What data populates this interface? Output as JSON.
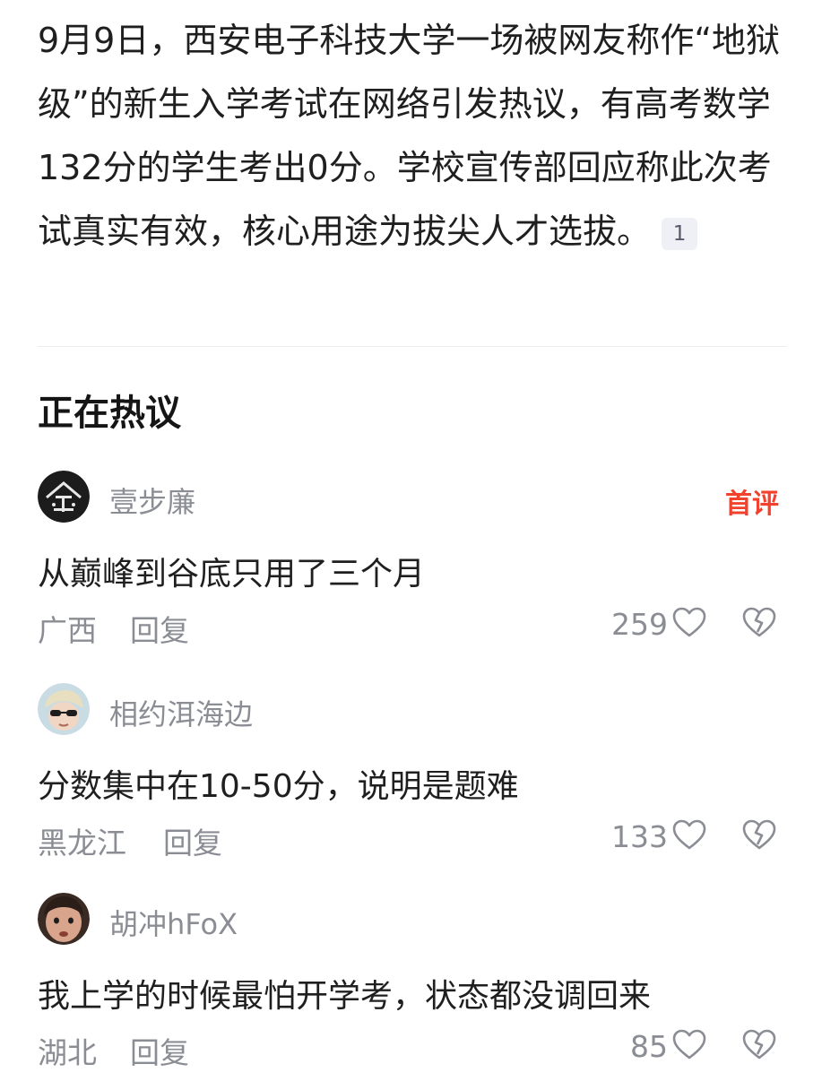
{
  "article": {
    "text": "9月9日，西安电子科技大学一场被网友称作“地狱级”的新生入学考试在网络引发热议，有高考数学132分的学生考出0分。学校宣传部回应称此次考试真实有效，核心用途为拔尖人才选拔。",
    "reference": "1"
  },
  "section_title": "正在热议",
  "comments": [
    {
      "username": "壹步廉",
      "badge": "首评",
      "text": "从巅峰到谷底只用了三个月",
      "location": "广西",
      "reply_label": "回复",
      "likes": "259"
    },
    {
      "username": "相约洱海边",
      "badge": "",
      "text": "分数集中在10-50分，说明是题难",
      "location": "黑龙江",
      "reply_label": "回复",
      "likes": "133"
    },
    {
      "username": "胡冲hFoX",
      "badge": "",
      "text": "我上学的时候最怕开学考，状态都没调回来",
      "location": "湖北",
      "reply_label": "回复",
      "likes": "85"
    }
  ],
  "colors": {
    "accent_red": "#f2422e",
    "muted_text": "#8b8d94",
    "body_text": "#1f1f1f"
  },
  "icons": [
    "heart-outline-icon",
    "broken-heart-icon"
  ]
}
